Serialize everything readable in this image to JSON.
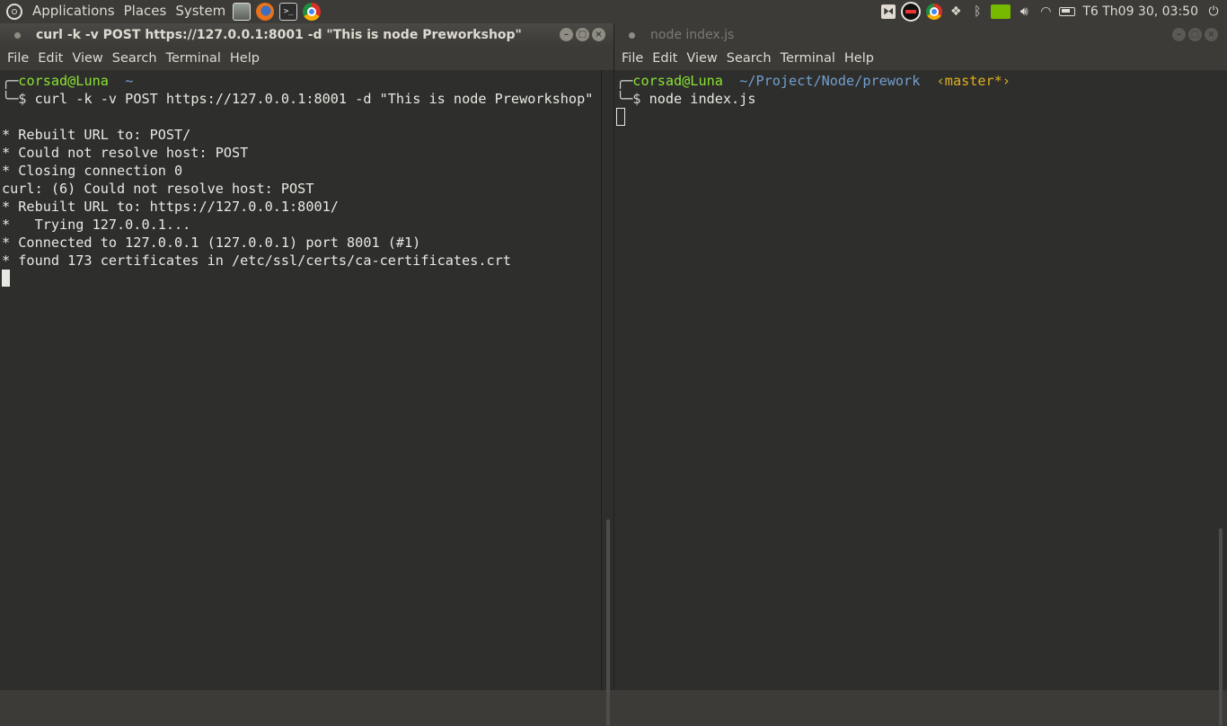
{
  "panel": {
    "menus": [
      "Applications",
      "Places",
      "System"
    ],
    "launchers": [
      "files-icon",
      "firefox-icon",
      "terminal-icon",
      "chrome-icon"
    ],
    "tray_icons": [
      "screenshot-icon",
      "record-icon",
      "chrome-icon",
      "dropbox-icon",
      "bluetooth-icon",
      "nvidia-icon",
      "volume-icon",
      "wifi-icon",
      "battery-icon"
    ],
    "clock": "T6 Th09 30, 03:50",
    "terminal_glyph": ">_"
  },
  "left_window": {
    "title": "curl -k -v POST https://127.0.0.1:8001 -d \"This is node Preworkshop\"",
    "menu": [
      "File",
      "Edit",
      "View",
      "Search",
      "Terminal",
      "Help"
    ],
    "prompt_user": "corsad@Luna",
    "prompt_dir": "~",
    "command": "curl -k -v POST https://127.0.0.1:8001 -d \"This is node Preworkshop\"",
    "output": [
      "",
      "* Rebuilt URL to: POST/",
      "* Could not resolve host: POST",
      "* Closing connection 0",
      "curl: (6) Could not resolve host: POST",
      "* Rebuilt URL to: https://127.0.0.1:8001/",
      "*   Trying 127.0.0.1...",
      "* Connected to 127.0.0.1 (127.0.0.1) port 8001 (#1)",
      "* found 173 certificates in /etc/ssl/certs/ca-certificates.crt"
    ]
  },
  "right_window": {
    "title": "node index.js",
    "menu": [
      "File",
      "Edit",
      "View",
      "Search",
      "Terminal",
      "Help"
    ],
    "prompt_user": "corsad@Luna",
    "prompt_dir": "~/Project/Node/prework",
    "prompt_branch": "‹master*›",
    "command": "node index.js"
  },
  "window_buttons": {
    "minimize": "–",
    "maximize": "□",
    "close": "×"
  },
  "prompt_glyphs": {
    "top": "╭─",
    "bottom": "╰─$"
  },
  "colors": {
    "terminal_bg": "#2e2e2c",
    "prompt_user": "#8ae234",
    "prompt_dir": "#729fcf",
    "git_branch": "#e0b020",
    "panel_bg": "#3c3b37"
  }
}
